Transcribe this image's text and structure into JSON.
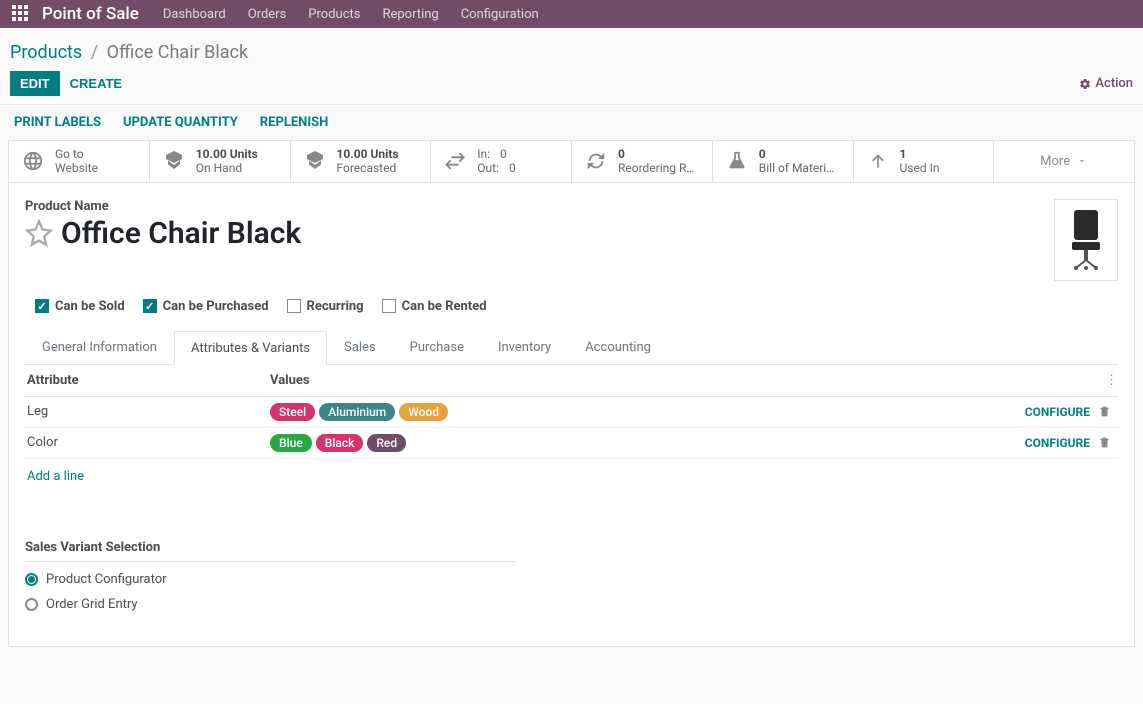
{
  "topbar": {
    "brand": "Point of Sale",
    "menu": [
      "Dashboard",
      "Orders",
      "Products",
      "Reporting",
      "Configuration"
    ]
  },
  "breadcrumb": {
    "parent": "Products",
    "current": "Office Chair Black"
  },
  "toolbar": {
    "edit": "EDIT",
    "create": "CREATE",
    "action": "Action"
  },
  "secondary": [
    "PRINT LABELS",
    "UPDATE QUANTITY",
    "REPLENISH"
  ],
  "statbar": {
    "website": {
      "l1": "Go to",
      "l2": "Website"
    },
    "onhand": {
      "l1": "10.00 Units",
      "l2": "On Hand"
    },
    "forecast": {
      "l1": "10.00 Units",
      "l2": "Forecasted"
    },
    "inout": {
      "in_label": "In:",
      "in_val": "0",
      "out_label": "Out:",
      "out_val": "0"
    },
    "reorder": {
      "l1": "0",
      "l2": "Reordering R…"
    },
    "bom": {
      "l1": "0",
      "l2": "Bill of Materi…"
    },
    "usedin": {
      "l1": "1",
      "l2": "Used In"
    },
    "more": "More"
  },
  "product": {
    "field_label": "Product Name",
    "name": "Office Chair Black"
  },
  "checkboxes": {
    "sold": {
      "label": "Can be Sold",
      "checked": true
    },
    "purchased": {
      "label": "Can be Purchased",
      "checked": true
    },
    "recurring": {
      "label": "Recurring",
      "checked": false
    },
    "rented": {
      "label": "Can be Rented",
      "checked": false
    }
  },
  "tabs": [
    "General Information",
    "Attributes & Variants",
    "Sales",
    "Purchase",
    "Inventory",
    "Accounting"
  ],
  "active_tab": 1,
  "attributes": {
    "header_attr": "Attribute",
    "header_val": "Values",
    "configure": "CONFIGURE",
    "add_line": "Add a line",
    "rows": [
      {
        "name": "Leg",
        "values": [
          {
            "text": "Steel",
            "color": "pink"
          },
          {
            "text": "Aluminium",
            "color": "teal"
          },
          {
            "text": "Wood",
            "color": "orange"
          }
        ]
      },
      {
        "name": "Color",
        "values": [
          {
            "text": "Blue",
            "color": "green"
          },
          {
            "text": "Black",
            "color": "pink"
          },
          {
            "text": "Red",
            "color": "purple"
          }
        ]
      }
    ]
  },
  "variant_selection": {
    "label": "Sales Variant Selection",
    "options": [
      {
        "label": "Product Configurator",
        "checked": true
      },
      {
        "label": "Order Grid Entry",
        "checked": false
      }
    ]
  }
}
